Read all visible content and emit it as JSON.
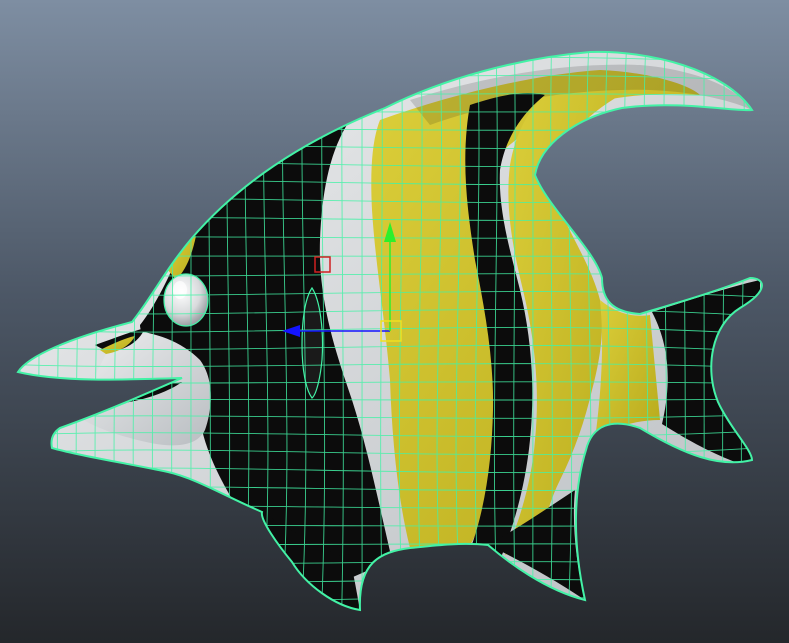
{
  "viewport": {
    "background_top": "#7e8ea2",
    "background_bottom": "#24272b"
  },
  "model": {
    "shape": "moorish-idol-fish",
    "wireframe_color": "#43f2a6",
    "colors": {
      "white": "#e2e4e6",
      "black": "#0c0c0c",
      "yellow": "#d2c52a",
      "shade": "#a9adb1"
    }
  },
  "manipulator": {
    "tool": "move-tool",
    "x_axis_color": "#1414ff",
    "y_axis_color": "#2cf02c",
    "center_handle_color": "#f0e020",
    "rotate_pivot_color": "#d02020"
  }
}
